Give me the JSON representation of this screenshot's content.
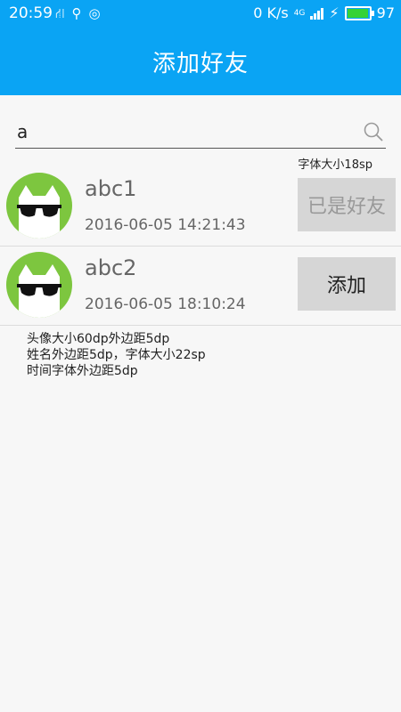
{
  "status_bar": {
    "time": "20:59",
    "network_speed": "0 K/s",
    "network_type": "4G",
    "battery_level": "97"
  },
  "app_bar": {
    "title": "添加好友"
  },
  "search": {
    "value": "a",
    "placeholder": ""
  },
  "font_size_note": "字体大小18sp",
  "results": [
    {
      "name": "abc1",
      "time": "2016-06-05 14:21:43",
      "action": "已是好友",
      "state": "disabled"
    },
    {
      "name": "abc2",
      "time": "2016-06-05 18:10:24",
      "action": "添加",
      "state": "enabled"
    }
  ],
  "notes": [
    "头像大小60dp外边距5dp",
    "姓名外边距5dp，字体大小22sp",
    "时间字体外边距5dp"
  ],
  "colors": {
    "primary": "#0aa4f4",
    "avatar_bg": "#7dc63f",
    "button_bg": "#d6d6d6",
    "battery_fill": "#35d235"
  },
  "icons": [
    "usb-icon",
    "share-icon",
    "hotspot-icon",
    "signal-icon",
    "charging-icon",
    "battery-icon",
    "search-icon",
    "cat-avatar-icon"
  ]
}
